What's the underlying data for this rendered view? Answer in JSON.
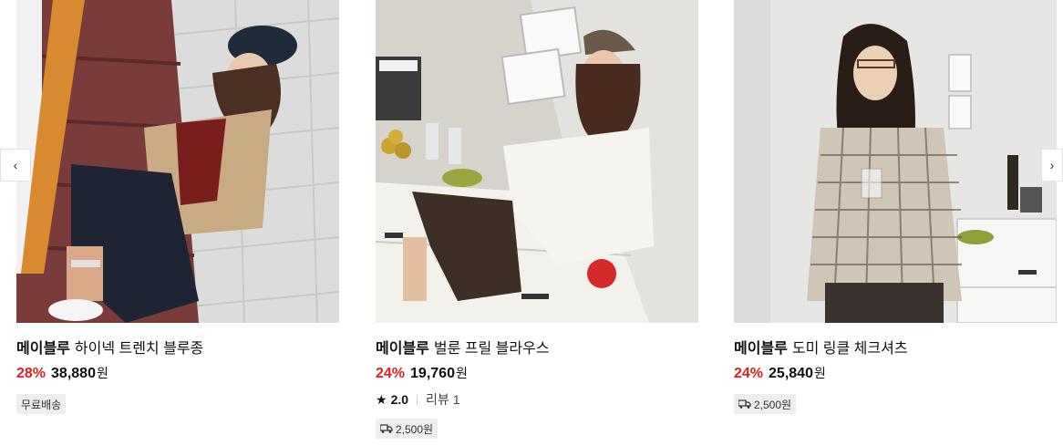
{
  "products": [
    {
      "image_alt": "",
      "brand": "메이블루",
      "name": "하이넥 트렌치 블루종",
      "discount": "28%",
      "price": "38,880",
      "currency": "원",
      "shipping_badge": "무료배송"
    },
    {
      "image_alt": "",
      "brand": "메이블루",
      "name": "벌룬 프릴 블라우스",
      "discount": "24%",
      "price": "19,760",
      "currency": "원",
      "rating": "2.0",
      "review_label": "리뷰",
      "review_count": "1",
      "shipping_badge": "2,500원"
    },
    {
      "image_alt": "",
      "brand": "메이블루",
      "name": "도미 링클 체크셔츠",
      "discount": "24%",
      "price": "25,840",
      "currency": "원",
      "shipping_badge": "2,500원"
    }
  ],
  "nav": {
    "prev_icon": "‹",
    "next_icon": "›"
  },
  "colors": {
    "discount": "#e02020",
    "badge_bg": "#eeeeee"
  }
}
